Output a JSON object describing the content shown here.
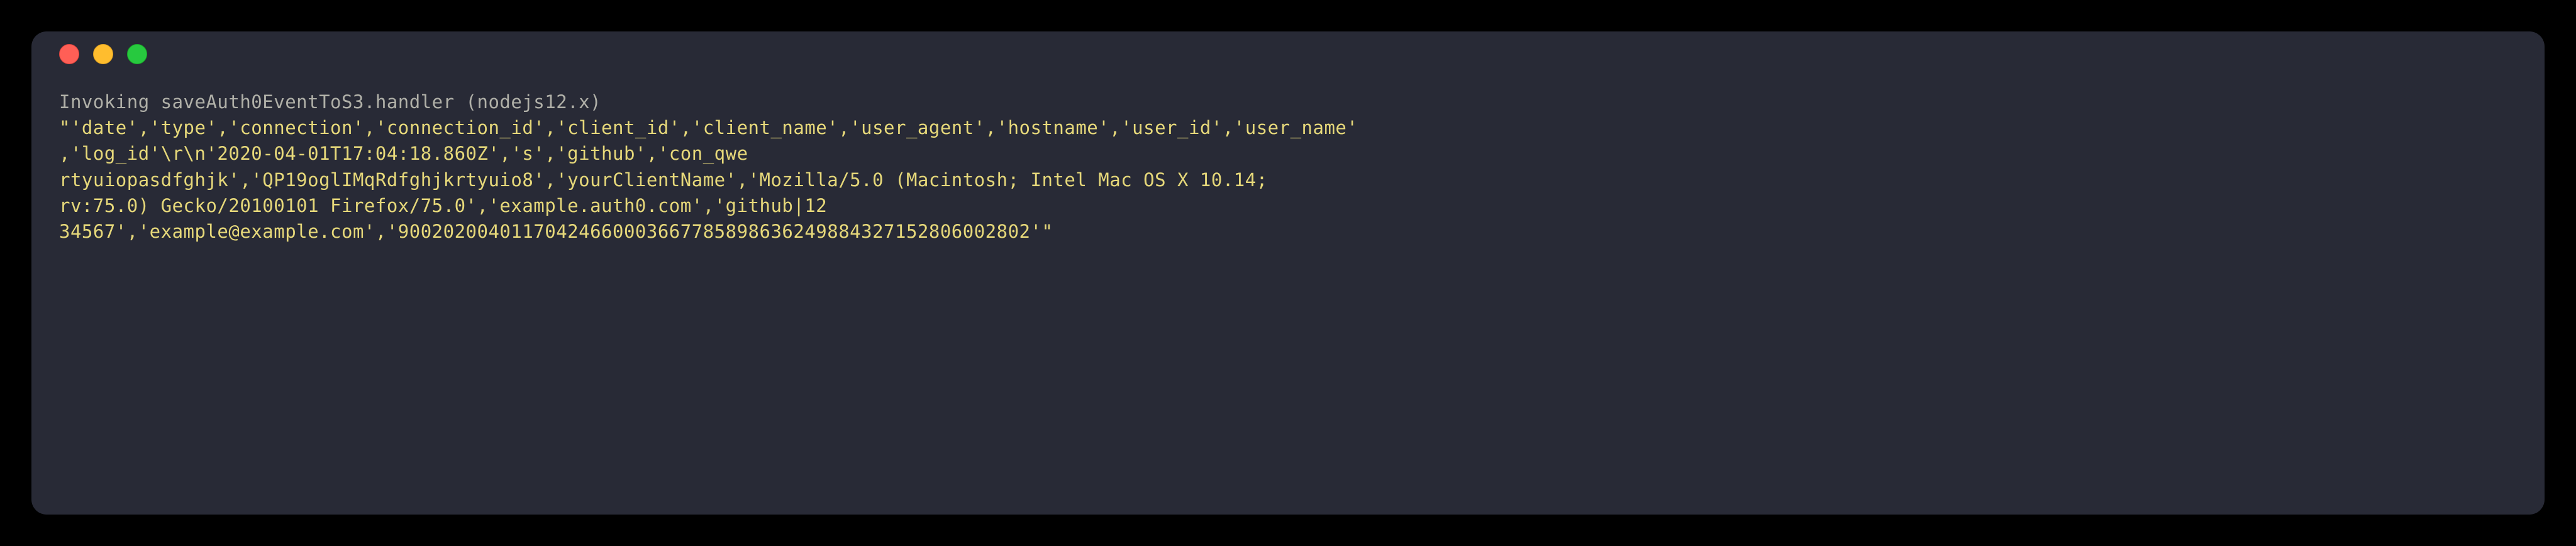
{
  "terminal": {
    "invoke_line": "Invoking saveAuth0EventToS3.handler (nodejs12.x)",
    "output_line1": "\"'date','type','connection','connection_id','client_id','client_name','user_agent','hostname','user_id','user_name'",
    "output_line2": ",'log_id'\\r\\n'2020-04-01T17:04:18.860Z','s','github','con_qwe",
    "output_line3": "rtyuiopasdfghjk','QP19oglIMqRdfghjkrtyuio8','yourClientName','Mozilla/5.0 (Macintosh; Intel Mac OS X 10.14;",
    "output_line4": "rv:75.0) Gecko/20100101 Firefox/75.0','example.auth0.com','github|12",
    "output_line5": "34567','example@example.com','90020200401170424660003667785898636249884327152806002802'\""
  }
}
